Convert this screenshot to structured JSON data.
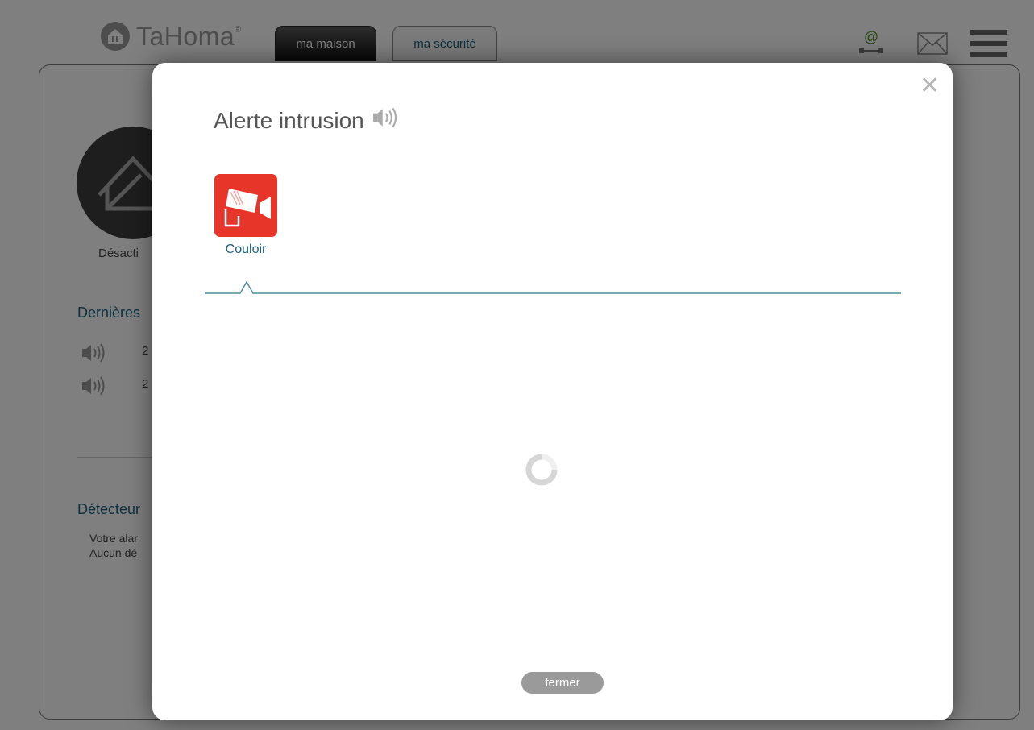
{
  "app": {
    "brand_name": "TaHoma",
    "brand_mark": "®",
    "tabs": [
      {
        "label": "ma maison",
        "active": true
      },
      {
        "label": "ma sécurité",
        "active": false
      }
    ],
    "header_icons": [
      "connection-status-icon",
      "mail-icon",
      "menu-icon"
    ],
    "status_label": "Désacti",
    "sections": {
      "last_alarms_title": "Dernières",
      "last_alarms_rows": [
        {
          "icon": "speaker-icon",
          "text": "2"
        },
        {
          "icon": "speaker-icon",
          "text": "2"
        }
      ],
      "detectors_title": "Détecteur",
      "detectors_lines": [
        "Votre alar",
        "Aucun dé"
      ]
    }
  },
  "modal": {
    "title": "Alerte intrusion",
    "title_icon": "speaker-icon",
    "close_icon": "close-icon",
    "devices": [
      {
        "label": "Couloir",
        "icon": "security-camera-icon",
        "color": "#e8352a"
      }
    ],
    "loading_icon": "spinner-icon",
    "close_button_label": "fermer"
  },
  "colors": {
    "accent_blue": "#1a5e7a",
    "alert_red": "#e8352a",
    "divider_teal": "#4e8f98"
  }
}
